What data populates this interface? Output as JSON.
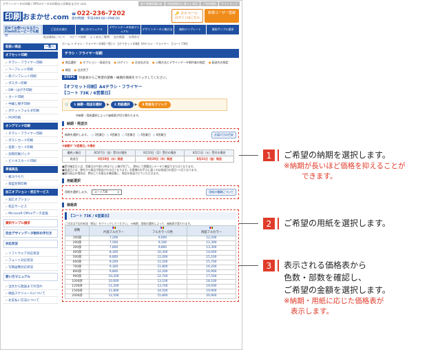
{
  "site": {
    "tagline": "デザインデータの印刷 / Officeデータの印刷なら印刷おまかせ.com",
    "top_links": [
      "個人情報保護方針",
      "特定商取引に基づく表記",
      "ご利用規約",
      "サイトマップ"
    ],
    "logo_kanji": "印刷",
    "logo_rest": "おまかせ.com",
    "phone": "022-236-7202",
    "phone_hours": "受付時間：平日AM9:00〜PM6:00",
    "mypage_label": "マイページ",
    "mypage_sub": "ログインはこちら",
    "guest_label": "新規ユーザー登録"
  },
  "nav": {
    "banner": "初めてお使いになる方へ",
    "banner_sub": "Flashのムービーでも紹介",
    "items": [
      "ご注文の流れ",
      "使い方マニュアル",
      "デザインデータ作成マニュアル",
      "デザインデータ入稿方法",
      "無料テンプレート",
      "資料サンプル請求"
    ],
    "sub": [
      "配送業務について",
      "スピード納期",
      "よくあるご質問",
      "会社概要",
      "お問合せ"
    ]
  },
  "sidebar": {
    "head_main": "取扱い商品",
    "head_button": "一覧へ",
    "offset_head": "オフセット印刷",
    "offset_items": [
      "チラシ・フライヤー印刷",
      "リーフレット印刷",
      "折パンフレット印刷",
      "ポスター印刷",
      "DM・はがき印刷",
      "カード印刷",
      "中綴じ冊子印刷",
      "ポケットフォルダ印刷",
      "POP印刷"
    ],
    "ondemand_head": "オンデマンド印刷",
    "ondemand_items": [
      "チラシ・フライヤー印刷",
      "ポストカード印刷",
      "名刺・カード印刷",
      "封筒印刷パック",
      "ビジネスカード印刷"
    ],
    "special_head": "単価商品",
    "special_items": [
      "紙ヨウちり",
      "角型封筒印刷"
    ],
    "option_head": "加工オプション・校正サービス",
    "option_items": [
      "加工オプション",
      "校正サービス",
      "Microsoft Officeデータ変換"
    ],
    "box_sample": "資料サンプル請求",
    "box_design": "完全デザインデータ制作の手引き",
    "box_support": "対応状況",
    "support_items": [
      "ソフトウェア対応状況",
      "フォント対応状況",
      "写真画像対応状況"
    ],
    "box_manual": "使い方マニュアル",
    "manual_items": [
      "注文から発送までの流れ",
      "納品スケジュールについて",
      "お支払い方法について"
    ]
  },
  "main": {
    "breadcrumb": "ホーム > チラシ・フライヤー印刷[一覧] > 【オフセット印刷】A4チラシ・フライヤー 【コート73K】",
    "title": "チラシ・フライヤー印刷",
    "step_icons": [
      "商品選択",
      "オプション・発送方法",
      "ログイン",
      "お支払方法",
      "入稿方法とデザインデータ制作者の指定",
      "配送先の指定",
      "確認",
      "注文完了"
    ],
    "step_badge": "STEP1",
    "step_text": "料金表からご希望の部数・納期の価格をクリックしてください。",
    "product_title_1": "【オフセット印刷】A4チラシ・フライヤー",
    "product_title_2": "【コート 73K / 6営業日】",
    "flow": [
      "納期・発送日選択",
      "用紙選択",
      "料金をクリック"
    ],
    "flow_note": "※納期・用紙選択によって価格表が切り替わります。",
    "section_delivery": "納期・発送日",
    "delivery_prompt": "納期を選択します。",
    "delivery_options": [
      "3営業日",
      "4営業日",
      "5営業日",
      "6営業日",
      "8営業日"
    ],
    "delivery_button": "お届け日の目安",
    "calendar_note": "※納期が「6営業日」の場合",
    "calendar": [
      {
        "label": "最終入稿日",
        "dates": [
          "8月07日（金）受付の場合",
          "8月10日（月）受付の場合",
          "8月11日（火）受付の場合"
        ]
      },
      {
        "label": "発送日",
        "dates": [
          "8月19日（水）発送",
          "8月20日（木）発送",
          "8月21日（金）発送"
        ]
      }
    ],
    "notes": [
      "■受付確定日とは、営業日の午前11時までに入稿が完了し、弊社にて問題ないデータと確認できた日となります。",
      "■発送日とは、弊社から商品が配送される日となります。お客様のお手元に届くのは発送日の翌日〜2日となります。",
      "■銀行振込の場合は、弊社にてお振込を確認後に、商品を発送させていただきます。"
    ],
    "section_paper": "用紙選択",
    "paper_prompt": "用紙を選択します。",
    "paper_selected": "コート73K",
    "paper_button": "用紙の種類について",
    "section_price": "価格表",
    "price_head": "【コート 73K / 6営業日】",
    "price_hint": "ご注文は下記の料金（税込）をクリックしてください。 ※納期、用紙の選択によって、価格表が変わります。",
    "price_columns": [
      "部数",
      "片面フルカラー",
      "フルカラー/1色",
      "両面フルカラー"
    ],
    "price_rows": [
      [
        "100部",
        "7,200",
        "9,000",
        "12,200"
      ],
      [
        "200部",
        "7,500",
        "9,100",
        "12,300"
      ],
      [
        "300部",
        "7,800",
        "9,800",
        "13,300"
      ],
      [
        "400部",
        "8,300",
        "10,300",
        "14,000"
      ],
      [
        "500部",
        "8,800",
        "11,000",
        "15,100"
      ],
      [
        "600部",
        "9,200",
        "11,500",
        "15,700"
      ],
      [
        "700部",
        "9,300",
        "11,800",
        "16,200"
      ],
      [
        "800部",
        "9,800",
        "12,200",
        "16,900"
      ],
      [
        "900部",
        "10,200",
        "12,700",
        "17,500"
      ],
      [
        "1000部",
        "10,600",
        "13,100",
        "18,100"
      ],
      [
        "1200部",
        "11,200",
        "13,700",
        "19,000"
      ],
      [
        "1500部",
        "11,800",
        "14,500",
        "19,900"
      ],
      [
        "2000部",
        "12,500",
        "15,800",
        "20,900"
      ]
    ]
  },
  "annotations": [
    {
      "num": "1",
      "text": "ご希望の納期を選択します。",
      "warn_1": "※納期が長いほど価格を抑えることが",
      "warn_2": "できます。"
    },
    {
      "num": "2",
      "text": "ご希望の用紙を選択します。"
    },
    {
      "num": "3",
      "line_1": "表示される価格表から",
      "line_2": "色数・部数を確認し、",
      "line_3": "ご希望の金額を選択します。",
      "warn_1": "※納期・用紙に応じた価格表が",
      "warn_2": "表示します。"
    }
  ]
}
